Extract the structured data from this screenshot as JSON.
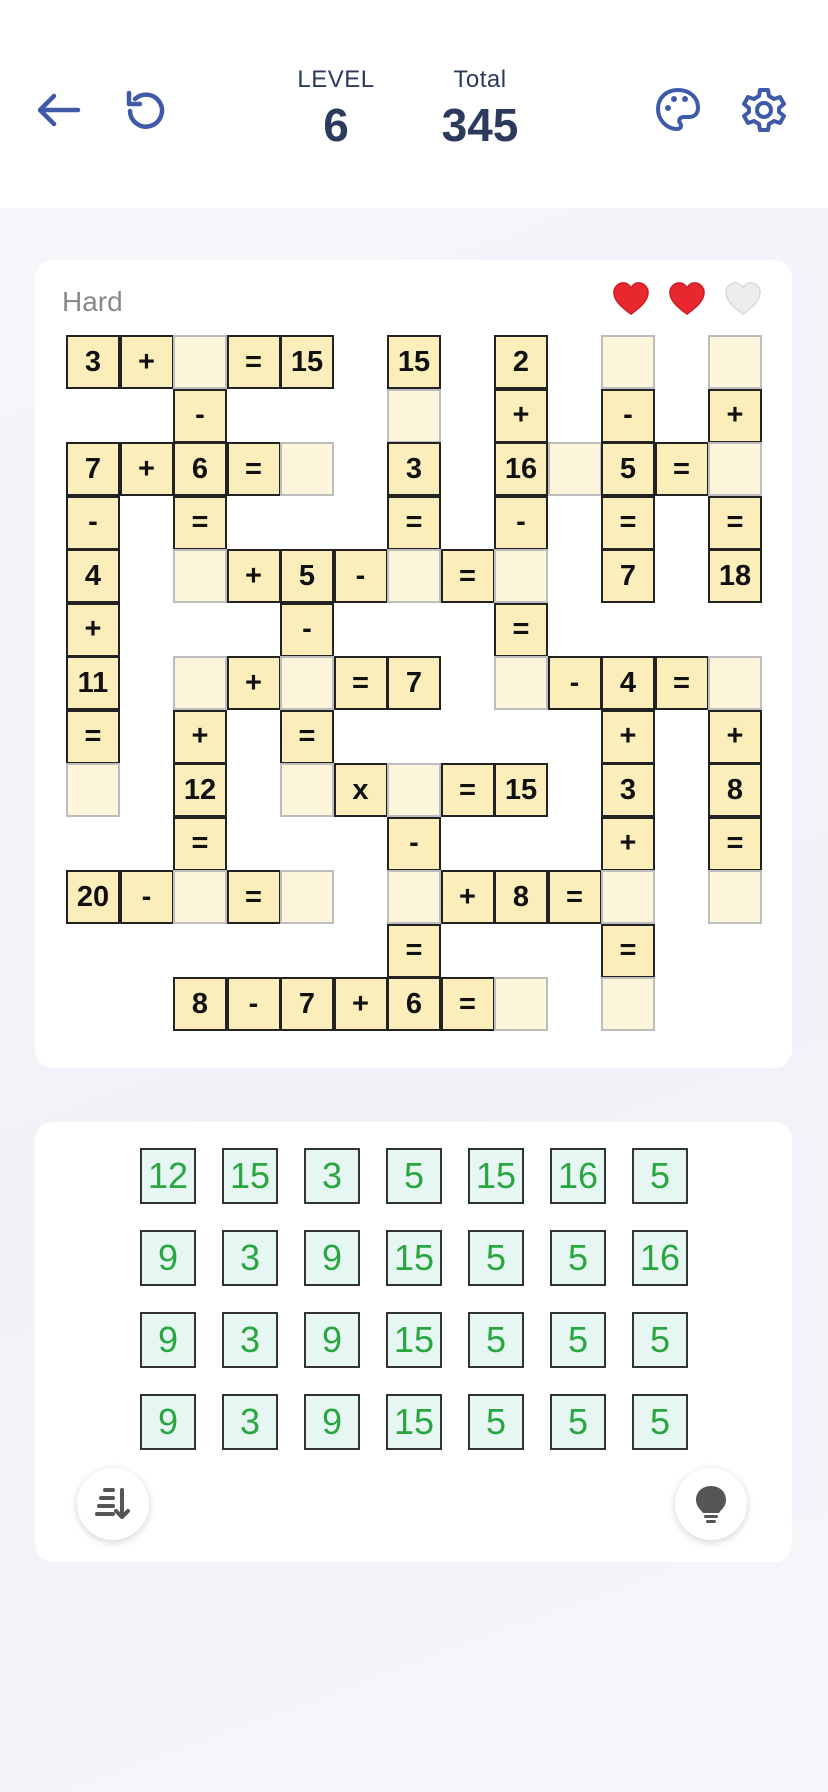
{
  "header": {
    "level_label": "LEVEL",
    "level_value": "6",
    "total_label": "Total",
    "total_value": "345",
    "icons": [
      "back-arrow-icon",
      "restart-icon",
      "palette-icon",
      "gear-icon"
    ],
    "accent_color": "#3f5aa8"
  },
  "board": {
    "difficulty": "Hard",
    "lives_total": 3,
    "lives_remaining": 2,
    "cells": [
      {
        "r": 0,
        "c": 0,
        "t": "3"
      },
      {
        "r": 0,
        "c": 1,
        "t": "+"
      },
      {
        "r": 0,
        "c": 2,
        "t": ""
      },
      {
        "r": 0,
        "c": 3,
        "t": "="
      },
      {
        "r": 0,
        "c": 4,
        "t": "15"
      },
      {
        "r": 0,
        "c": 6,
        "t": "15"
      },
      {
        "r": 0,
        "c": 8,
        "t": "2"
      },
      {
        "r": 0,
        "c": 10,
        "t": ""
      },
      {
        "r": 0,
        "c": 12,
        "t": ""
      },
      {
        "r": 1,
        "c": 2,
        "t": "-"
      },
      {
        "r": 1,
        "c": 6,
        "t": ""
      },
      {
        "r": 1,
        "c": 8,
        "t": "+"
      },
      {
        "r": 1,
        "c": 10,
        "t": "-"
      },
      {
        "r": 1,
        "c": 12,
        "t": "+"
      },
      {
        "r": 2,
        "c": 0,
        "t": "7"
      },
      {
        "r": 2,
        "c": 1,
        "t": "+"
      },
      {
        "r": 2,
        "c": 2,
        "t": "6"
      },
      {
        "r": 2,
        "c": 3,
        "t": "="
      },
      {
        "r": 2,
        "c": 4,
        "t": ""
      },
      {
        "r": 2,
        "c": 6,
        "t": "3"
      },
      {
        "r": 2,
        "c": 8,
        "t": "16"
      },
      {
        "r": 2,
        "c": 9,
        "t": ""
      },
      {
        "r": 2,
        "c": 10,
        "t": "5"
      },
      {
        "r": 2,
        "c": 11,
        "t": "="
      },
      {
        "r": 2,
        "c": 12,
        "t": ""
      },
      {
        "r": 3,
        "c": 0,
        "t": "-"
      },
      {
        "r": 3,
        "c": 2,
        "t": "="
      },
      {
        "r": 3,
        "c": 6,
        "t": "="
      },
      {
        "r": 3,
        "c": 8,
        "t": "-"
      },
      {
        "r": 3,
        "c": 10,
        "t": "="
      },
      {
        "r": 3,
        "c": 12,
        "t": "="
      },
      {
        "r": 4,
        "c": 0,
        "t": "4"
      },
      {
        "r": 4,
        "c": 2,
        "t": ""
      },
      {
        "r": 4,
        "c": 3,
        "t": "+"
      },
      {
        "r": 4,
        "c": 4,
        "t": "5"
      },
      {
        "r": 4,
        "c": 5,
        "t": "-"
      },
      {
        "r": 4,
        "c": 6,
        "t": ""
      },
      {
        "r": 4,
        "c": 7,
        "t": "="
      },
      {
        "r": 4,
        "c": 8,
        "t": ""
      },
      {
        "r": 4,
        "c": 10,
        "t": "7"
      },
      {
        "r": 4,
        "c": 12,
        "t": "18"
      },
      {
        "r": 5,
        "c": 0,
        "t": "+"
      },
      {
        "r": 5,
        "c": 4,
        "t": "-"
      },
      {
        "r": 5,
        "c": 8,
        "t": "="
      },
      {
        "r": 6,
        "c": 0,
        "t": "11"
      },
      {
        "r": 6,
        "c": 2,
        "t": ""
      },
      {
        "r": 6,
        "c": 3,
        "t": "+"
      },
      {
        "r": 6,
        "c": 4,
        "t": ""
      },
      {
        "r": 6,
        "c": 5,
        "t": "="
      },
      {
        "r": 6,
        "c": 6,
        "t": "7"
      },
      {
        "r": 6,
        "c": 8,
        "t": ""
      },
      {
        "r": 6,
        "c": 9,
        "t": "-"
      },
      {
        "r": 6,
        "c": 10,
        "t": "4"
      },
      {
        "r": 6,
        "c": 11,
        "t": "="
      },
      {
        "r": 6,
        "c": 12,
        "t": ""
      },
      {
        "r": 7,
        "c": 0,
        "t": "="
      },
      {
        "r": 7,
        "c": 2,
        "t": "+"
      },
      {
        "r": 7,
        "c": 4,
        "t": "="
      },
      {
        "r": 7,
        "c": 10,
        "t": "+"
      },
      {
        "r": 7,
        "c": 12,
        "t": "+"
      },
      {
        "r": 8,
        "c": 0,
        "t": ""
      },
      {
        "r": 8,
        "c": 2,
        "t": "12"
      },
      {
        "r": 8,
        "c": 4,
        "t": ""
      },
      {
        "r": 8,
        "c": 5,
        "t": "x"
      },
      {
        "r": 8,
        "c": 6,
        "t": ""
      },
      {
        "r": 8,
        "c": 7,
        "t": "="
      },
      {
        "r": 8,
        "c": 8,
        "t": "15"
      },
      {
        "r": 8,
        "c": 10,
        "t": "3"
      },
      {
        "r": 8,
        "c": 12,
        "t": "8"
      },
      {
        "r": 9,
        "c": 2,
        "t": "="
      },
      {
        "r": 9,
        "c": 6,
        "t": "-"
      },
      {
        "r": 9,
        "c": 10,
        "t": "+"
      },
      {
        "r": 9,
        "c": 12,
        "t": "="
      },
      {
        "r": 10,
        "c": 0,
        "t": "20"
      },
      {
        "r": 10,
        "c": 1,
        "t": "-"
      },
      {
        "r": 10,
        "c": 2,
        "t": ""
      },
      {
        "r": 10,
        "c": 3,
        "t": "="
      },
      {
        "r": 10,
        "c": 4,
        "t": ""
      },
      {
        "r": 10,
        "c": 6,
        "t": ""
      },
      {
        "r": 10,
        "c": 7,
        "t": "+"
      },
      {
        "r": 10,
        "c": 8,
        "t": "8"
      },
      {
        "r": 10,
        "c": 9,
        "t": "="
      },
      {
        "r": 10,
        "c": 10,
        "t": ""
      },
      {
        "r": 10,
        "c": 12,
        "t": ""
      },
      {
        "r": 11,
        "c": 6,
        "t": "="
      },
      {
        "r": 11,
        "c": 10,
        "t": "="
      },
      {
        "r": 12,
        "c": 2,
        "t": "8"
      },
      {
        "r": 12,
        "c": 3,
        "t": "-"
      },
      {
        "r": 12,
        "c": 4,
        "t": "7"
      },
      {
        "r": 12,
        "c": 5,
        "t": "+"
      },
      {
        "r": 12,
        "c": 6,
        "t": "6"
      },
      {
        "r": 12,
        "c": 7,
        "t": "="
      },
      {
        "r": 12,
        "c": 8,
        "t": ""
      },
      {
        "r": 12,
        "c": 10,
        "t": ""
      }
    ]
  },
  "bank": {
    "rows": [
      [
        "12",
        "15",
        "3",
        "5",
        "15",
        "16",
        "5"
      ],
      [
        "9",
        "3",
        "9",
        "15",
        "5",
        "5",
        "16"
      ],
      [
        "9",
        "3",
        "9",
        "15",
        "5",
        "5",
        "5"
      ],
      [
        "9",
        "3",
        "9",
        "15",
        "5",
        "5",
        "5"
      ]
    ],
    "tile_text_color": "#2aa640",
    "icons": [
      "sort-icon",
      "lightbulb-icon"
    ]
  }
}
